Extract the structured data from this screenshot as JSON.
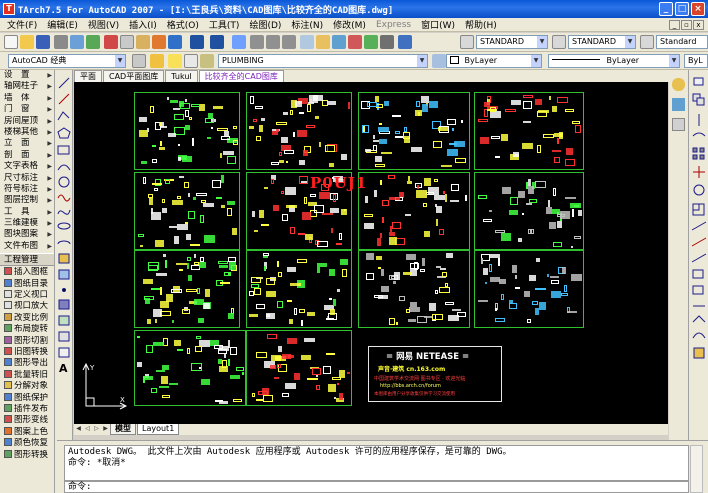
{
  "window": {
    "title": "TArch7.5 For AutoCAD 2007 - [I:\\王良兵\\资料\\CAD图库\\比较齐全的CAD图库.dwg]",
    "icon": "tarch-app-icon"
  },
  "menu": {
    "items": [
      "文件(F)",
      "编辑(E)",
      "视图(V)",
      "插入(I)",
      "格式(O)",
      "工具(T)",
      "绘图(D)",
      "标注(N)",
      "修改(M)",
      "Express",
      "窗口(W)",
      "帮助(H)"
    ]
  },
  "toolbar": {
    "text_style": "STANDARD",
    "dim_style": "STANDARD",
    "table_style": "Standard",
    "workspace": "AutoCAD 经典",
    "layer": "PLUMBING",
    "color": "ByLayer",
    "linetype": "ByLayer",
    "lineweight": "ByL"
  },
  "drawing_tabs": [
    "平面",
    "CAD平面图库",
    "Tukul",
    "比较齐全的CAD图库"
  ],
  "left_menu": {
    "items": [
      "设　置",
      "轴网柱子",
      "墙　体",
      "门　窗",
      "房间屋顶",
      "楼梯其他",
      "立　面",
      "剖　面",
      "文字表格",
      "尺寸标注",
      "符号标注",
      "图层控制",
      "工　具",
      "三维建模",
      "图块图案",
      "文件布图"
    ],
    "sub_header": "工程管理",
    "sub_items": [
      "插入图框",
      "图纸目录",
      "定义视口",
      "视口放大",
      "改变比例",
      "布局旋转",
      "图形切割",
      "旧图转换",
      "图形导出",
      "批量转旧",
      "分解对象",
      "图纸保护",
      "插件发布",
      "图形变线",
      "图案上色",
      "颜色恢复",
      "图形转换"
    ]
  },
  "canvas": {
    "info_title": "= 网易 NETEASE =",
    "info_sub": "声音·建筑        cn.163.com",
    "info_line1": "中国建筑学术交流网 图书专区 · 欢迎光临",
    "info_line2": "http://bbs.arch.cn/forum",
    "info_line3": "本图库由用户分享收集仅供学习交流使用",
    "plumbing_text": "P0UJ1"
  },
  "layout_tabs": [
    "模型",
    "Layout1"
  ],
  "command": {
    "line1": "Autodesk DWG。  此文件上次由 Autodesk 应用程序或 Autodesk 许可的应用程序保存，是可靠的 DWG。",
    "line2": "命令: *取消*",
    "prompt": "命令:"
  },
  "colors": {
    "titlebar": "#0a58d8",
    "canvas": "#000000",
    "sheet_border": "#2fbf2f",
    "active_tab": "#7a1fb8"
  }
}
